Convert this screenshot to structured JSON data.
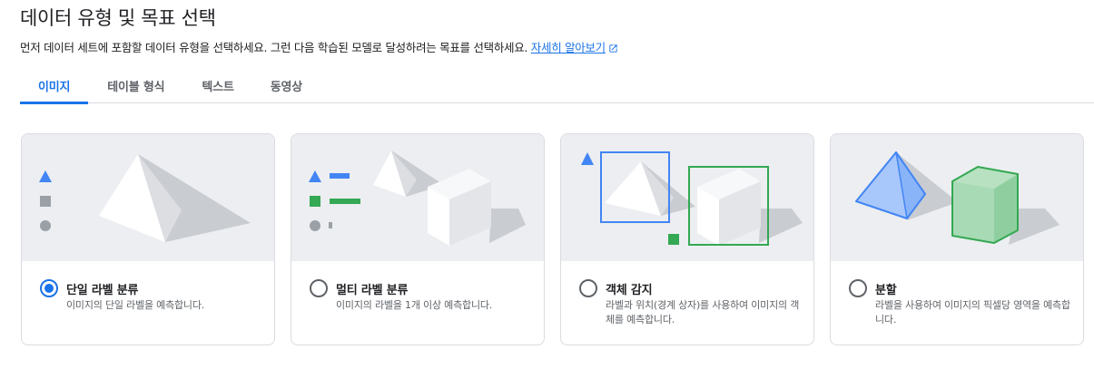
{
  "header": {
    "title": "데이터 유형 및 목표 선택",
    "subtitle": "먼저 데이터 세트에 포함할 데이터 유형을 선택하세요. 그런 다음 학습된 모델로 달성하려는 목표를 선택하세요.",
    "learn_more": "자세히 알아보기"
  },
  "tabs": [
    {
      "label": "이미지",
      "active": true
    },
    {
      "label": "테이블 형식",
      "active": false
    },
    {
      "label": "텍스트",
      "active": false
    },
    {
      "label": "동영상",
      "active": false
    }
  ],
  "cards": [
    {
      "title": "단일 라벨 분류",
      "description": "이미지의 단일 라벨을 예측합니다.",
      "selected": true
    },
    {
      "title": "멀티 라벨 분류",
      "description": "이미지의 라벨을 1개 이상 예측합니다.",
      "selected": false
    },
    {
      "title": "객체 감지",
      "description": "라벨과 위치(경계 상자)를 사용하여 이미지의 객체를 예측합니다.",
      "selected": false
    },
    {
      "title": "분할",
      "description": "라벨을 사용하여 이미지의 픽셀당 영역을 예측합니다.",
      "selected": false
    }
  ],
  "colors": {
    "accent": "#1a73e8",
    "blue_shape": "#4285f4",
    "green_shape": "#34a853",
    "illustration_bg": "#eceef1"
  },
  "icons": [
    "open-in-new-icon",
    "triangle-icon",
    "square-icon",
    "circle-icon",
    "pyramid-icon",
    "cube-icon",
    "bounding-box-icon"
  ]
}
